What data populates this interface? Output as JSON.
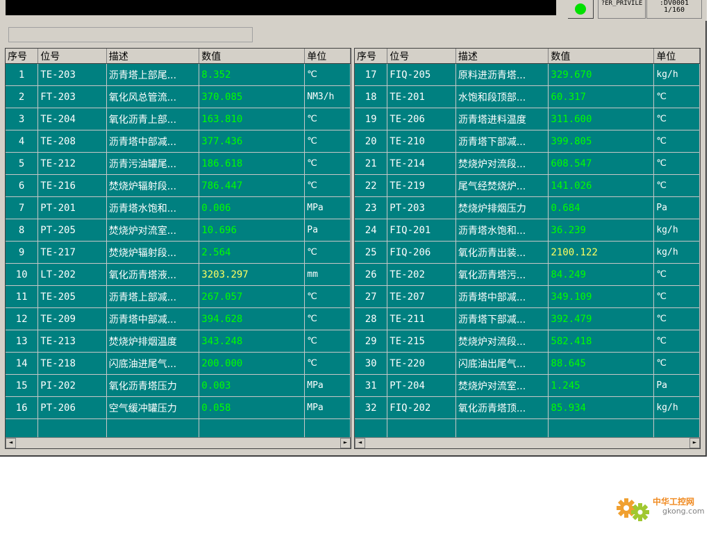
{
  "header": {
    "privilege_label": "?ER_PRIVILE",
    "device_label": ":DV0001",
    "page_indicator": "1/160",
    "indicator_color": "#00e000"
  },
  "status_field": "",
  "columns": [
    "序号",
    "位号",
    "描述",
    "数值",
    "单位"
  ],
  "left_table": [
    {
      "idx": "1",
      "tag": "TE-203",
      "desc": "沥青塔上部尾...",
      "value": "8.352",
      "unit": "℃"
    },
    {
      "idx": "2",
      "tag": "FT-203",
      "desc": "氧化风总管流...",
      "value": "370.085",
      "unit": "NM3/h"
    },
    {
      "idx": "3",
      "tag": "TE-204",
      "desc": "氧化沥青上部...",
      "value": "163.810",
      "unit": "℃"
    },
    {
      "idx": "4",
      "tag": "TE-208",
      "desc": "沥青塔中部减...",
      "value": "377.436",
      "unit": "℃"
    },
    {
      "idx": "5",
      "tag": "TE-212",
      "desc": "沥青污油罐尾...",
      "value": "186.618",
      "unit": "℃"
    },
    {
      "idx": "6",
      "tag": "TE-216",
      "desc": "焚烧炉辐射段...",
      "value": "786.447",
      "unit": "℃"
    },
    {
      "idx": "7",
      "tag": "PT-201",
      "desc": "沥青塔水饱和...",
      "value": "0.006",
      "unit": "MPa"
    },
    {
      "idx": "8",
      "tag": "PT-205",
      "desc": "焚烧炉对流室...",
      "value": "10.696",
      "unit": "Pa"
    },
    {
      "idx": "9",
      "tag": "TE-217",
      "desc": "焚烧炉辐射段...",
      "value": "2.564",
      "unit": "℃"
    },
    {
      "idx": "10",
      "tag": "LT-202",
      "desc": "氧化沥青塔液...",
      "value": "3203.297",
      "unit": "mm"
    },
    {
      "idx": "11",
      "tag": "TE-205",
      "desc": "沥青塔上部减...",
      "value": "267.057",
      "unit": "℃"
    },
    {
      "idx": "12",
      "tag": "TE-209",
      "desc": "沥青塔中部减...",
      "value": "394.628",
      "unit": "℃"
    },
    {
      "idx": "13",
      "tag": "TE-213",
      "desc": "焚烧炉排烟温度",
      "value": "343.248",
      "unit": "℃"
    },
    {
      "idx": "14",
      "tag": "TE-218",
      "desc": "闪底油进尾气...",
      "value": "200.000",
      "unit": "℃"
    },
    {
      "idx": "15",
      "tag": "PI-202",
      "desc": "氧化沥青塔压力",
      "value": "0.003",
      "unit": "MPa"
    },
    {
      "idx": "16",
      "tag": "PT-206",
      "desc": "空气缓冲罐压力",
      "value": "0.058",
      "unit": "MPa"
    }
  ],
  "right_table": [
    {
      "idx": "17",
      "tag": "FIQ-205",
      "desc": "原料进沥青塔...",
      "value": "329.670",
      "unit": "kg/h"
    },
    {
      "idx": "18",
      "tag": "TE-201",
      "desc": "水饱和段顶部...",
      "value": "60.317",
      "unit": "℃"
    },
    {
      "idx": "19",
      "tag": "TE-206",
      "desc": "沥青塔进料温度",
      "value": "311.600",
      "unit": "℃"
    },
    {
      "idx": "20",
      "tag": "TE-210",
      "desc": "沥青塔下部减...",
      "value": "399.805",
      "unit": "℃"
    },
    {
      "idx": "21",
      "tag": "TE-214",
      "desc": "焚烧炉对流段...",
      "value": "608.547",
      "unit": "℃"
    },
    {
      "idx": "22",
      "tag": "TE-219",
      "desc": "尾气经焚烧炉...",
      "value": "141.026",
      "unit": "℃"
    },
    {
      "idx": "23",
      "tag": "PT-203",
      "desc": "焚烧炉排烟压力",
      "value": "0.684",
      "unit": "Pa"
    },
    {
      "idx": "24",
      "tag": "FIQ-201",
      "desc": "沥青塔水饱和...",
      "value": "36.239",
      "unit": "kg/h"
    },
    {
      "idx": "25",
      "tag": "FIQ-206",
      "desc": "氧化沥青出装...",
      "value": "2100.122",
      "unit": "kg/h"
    },
    {
      "idx": "26",
      "tag": "TE-202",
      "desc": "氧化沥青塔污...",
      "value": "84.249",
      "unit": "℃"
    },
    {
      "idx": "27",
      "tag": "TE-207",
      "desc": "沥青塔中部减...",
      "value": "349.109",
      "unit": "℃"
    },
    {
      "idx": "28",
      "tag": "TE-211",
      "desc": "沥青塔下部减...",
      "value": "392.479",
      "unit": "℃"
    },
    {
      "idx": "29",
      "tag": "TE-215",
      "desc": "焚烧炉对流段...",
      "value": "582.418",
      "unit": "℃"
    },
    {
      "idx": "30",
      "tag": "TE-220",
      "desc": "闪底油出尾气...",
      "value": "88.645",
      "unit": "℃"
    },
    {
      "idx": "31",
      "tag": "PT-204",
      "desc": "焚烧炉对流室...",
      "value": "1.245",
      "unit": "Pa"
    },
    {
      "idx": "32",
      "tag": "FIQ-202",
      "desc": "氧化沥青塔顶...",
      "value": "85.934",
      "unit": "kg/h"
    }
  ],
  "colors": {
    "grid_bg": "#008080",
    "value_text": "#00ff00",
    "value_highlight": "#ffff60",
    "cell_text": "#ffffff"
  },
  "scroll": {
    "left_arrow": "◄",
    "right_arrow": "►"
  },
  "watermark": {
    "text_cn": "中华工控网",
    "text_url": "gkong.com"
  }
}
